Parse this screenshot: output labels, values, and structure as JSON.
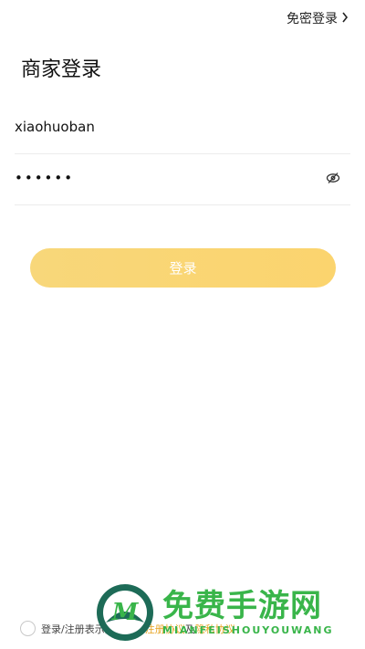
{
  "header": {
    "passwordless_login": "免密登录"
  },
  "page": {
    "title": "商家登录"
  },
  "form": {
    "username_value": "xiaohuoban",
    "password_value": "••••••",
    "login_label": "登录"
  },
  "agreement": {
    "prefix": "登录/注册表",
    "middle_hidden": "示同意",
    "user_agreement": "用户注册协议",
    "joiner": "及",
    "privacy_policy": "隐私协议"
  },
  "watermark": {
    "title": "免费手游网",
    "subtitle": "MIANFEISHOUYOUWANG",
    "logo_letter": "M"
  },
  "colors": {
    "accent": "#fbd46e",
    "link": "#e7a422",
    "watermark": "#39b54a"
  },
  "icons": {
    "chevron": "chevron-right-icon",
    "eye": "eye-off-icon"
  }
}
